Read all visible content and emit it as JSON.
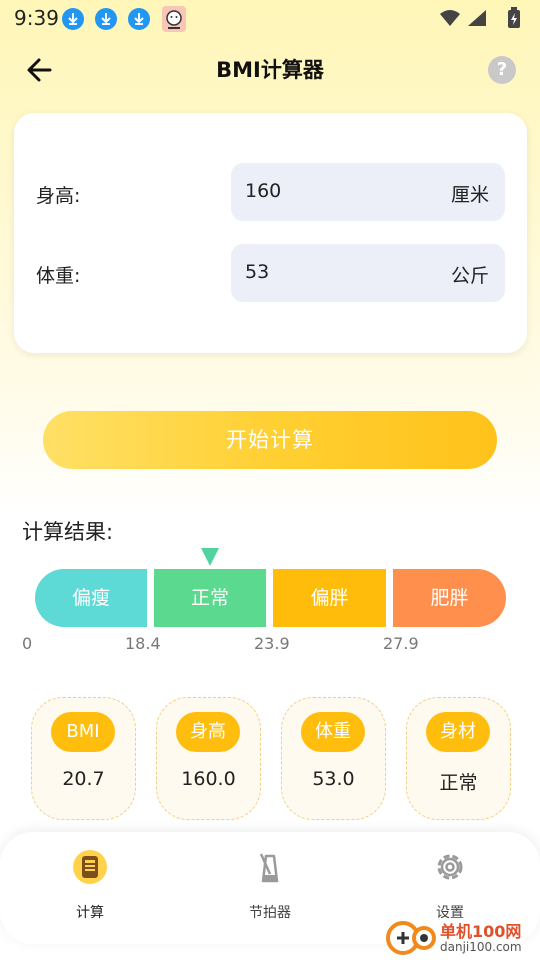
{
  "status_bar": {
    "time": "9:39",
    "icons": [
      "download-icon",
      "download-icon",
      "download-icon",
      "app-badge-icon",
      "wifi-icon",
      "signal-icon",
      "battery-charging-icon"
    ]
  },
  "header": {
    "title": "BMI计算器",
    "back_icon": "arrow-left-icon",
    "help_icon": "question-icon",
    "help_text": "?"
  },
  "form": {
    "height": {
      "label": "身高:",
      "value": "160",
      "unit": "厘米"
    },
    "weight": {
      "label": "体重:",
      "value": "53",
      "unit": "公斤"
    }
  },
  "calc_button": {
    "label": "开始计算"
  },
  "result": {
    "title": "计算结果:",
    "indicator_value": 20.7,
    "segments": [
      {
        "label": "偏瘦",
        "color": "#5ddad5"
      },
      {
        "label": "正常",
        "color": "#5bd98f"
      },
      {
        "label": "偏胖",
        "color": "#ffbc0a"
      },
      {
        "label": "肥胖",
        "color": "#ff8f4d"
      }
    ],
    "ticks": [
      "0",
      "18.4",
      "23.9",
      "27.9"
    ]
  },
  "stats": [
    {
      "label": "BMI",
      "value": "20.7"
    },
    {
      "label": "身高",
      "value": "160.0"
    },
    {
      "label": "体重",
      "value": "53.0"
    },
    {
      "label": "身材",
      "value": "正常"
    }
  ],
  "nav": [
    {
      "label": "计算",
      "icon": "calculator-icon",
      "active": true
    },
    {
      "label": "节拍器",
      "icon": "metronome-icon",
      "active": false
    },
    {
      "label": "设置",
      "icon": "gear-icon",
      "active": false
    }
  ],
  "watermark": {
    "text": "单机100网",
    "sub": "danji100.com"
  },
  "colors": {
    "accent": "#ffbe0d",
    "input_bg": "#eceef8",
    "indicator": "#4fd4a0"
  }
}
